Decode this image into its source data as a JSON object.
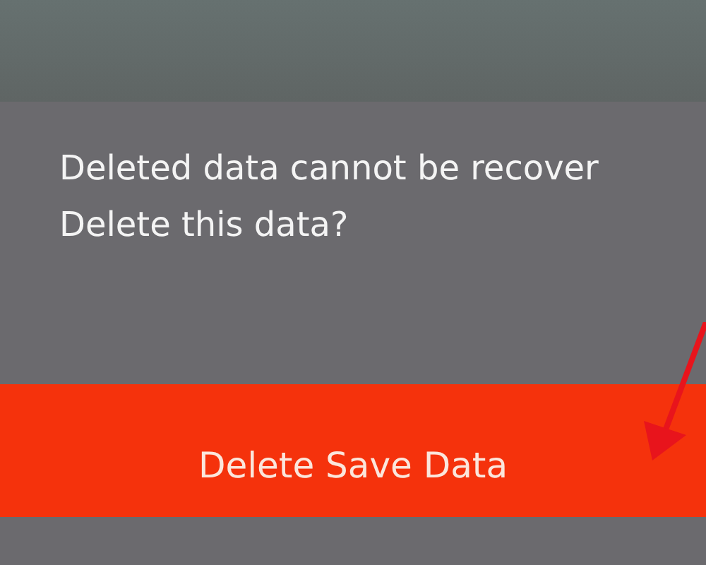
{
  "dialog": {
    "message_lines": [
      "Deleted data cannot be recover",
      "Delete this data?"
    ]
  },
  "confirm_button": {
    "label": "Delete Save Data"
  }
}
